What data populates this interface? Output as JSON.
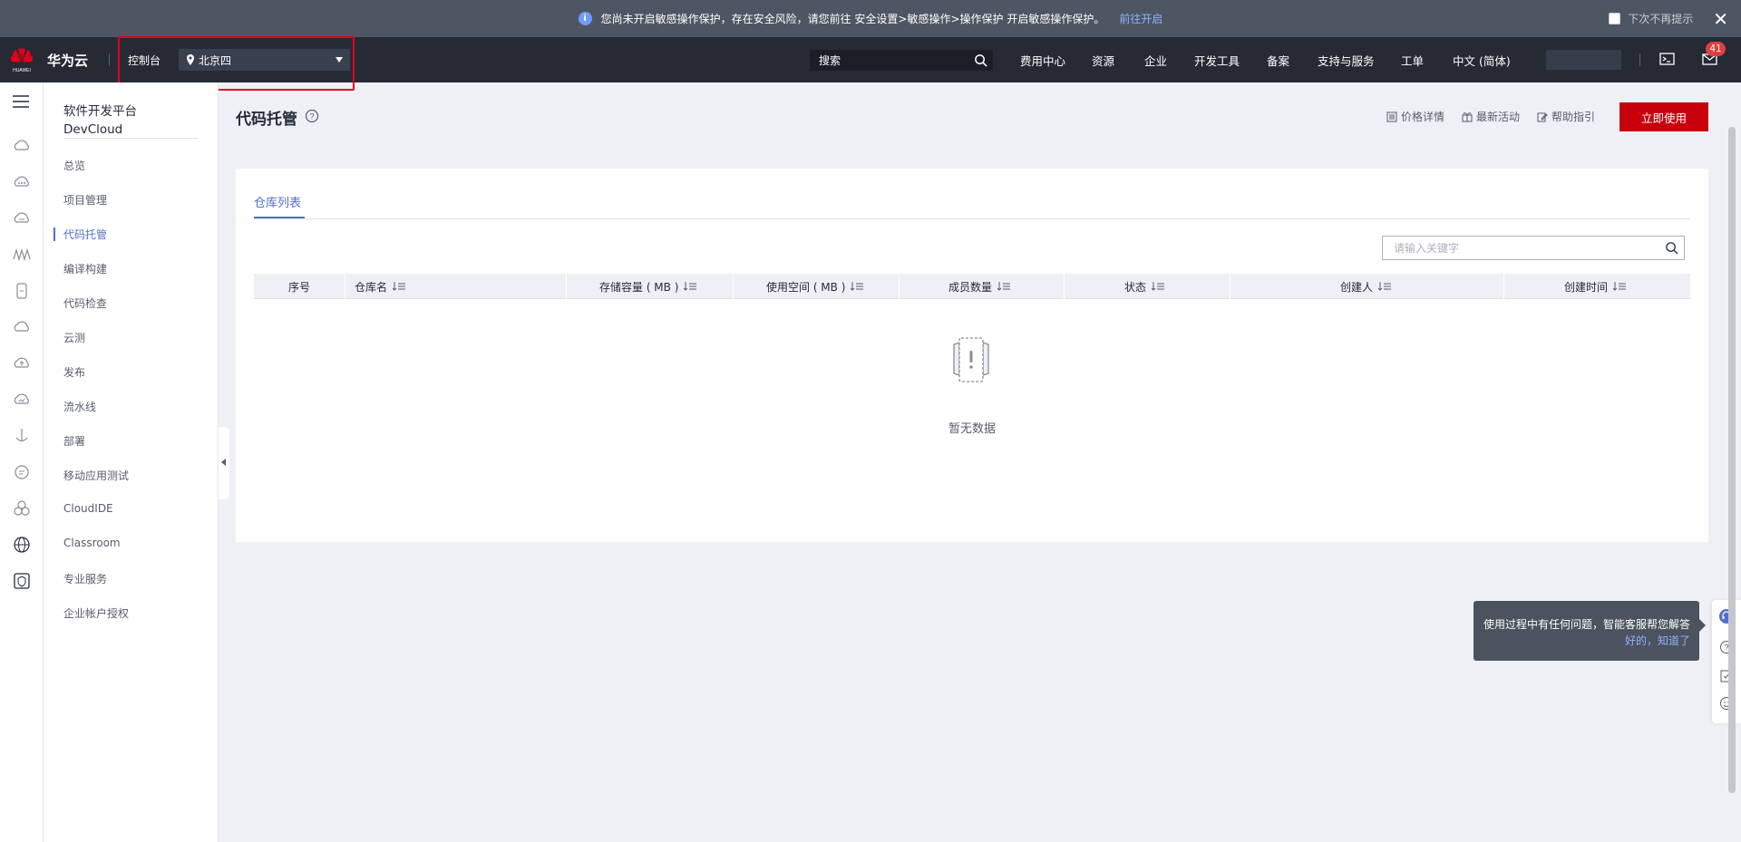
{
  "notice": {
    "text": "您尚未开启敏感操作保护，存在安全风险，请您前往 安全设置>敏感操作>操作保护 开启敏感操作保护。",
    "link": "前往开启",
    "dont_show": "下次不再提示"
  },
  "header": {
    "brand": "华为云",
    "logo_text": "HUAWEI",
    "console": "控制台",
    "region": "北京四",
    "search_placeholder": "搜索",
    "nav": [
      "费用中心",
      "资源",
      "企业",
      "开发工具",
      "备案",
      "支持与服务",
      "工单",
      "中文 (简体)"
    ],
    "message_count": "41"
  },
  "menu": {
    "title_line1": "软件开发平台",
    "title_line2": "DevCloud",
    "items": [
      "总览",
      "项目管理",
      "代码托管",
      "编译构建",
      "代码检查",
      "云测",
      "发布",
      "流水线",
      "部署",
      "移动应用测试",
      "CloudIDE",
      "Classroom",
      "专业服务",
      "企业帐户授权"
    ],
    "active_index": 2
  },
  "main": {
    "title": "代码托管",
    "links": {
      "pricing": "价格详情",
      "activities": "最新活动",
      "guide": "帮助指引"
    },
    "cta": "立即使用",
    "tab": "仓库列表",
    "search_placeholder": "请输入关键字",
    "columns": [
      "序号",
      "仓库名",
      "存储容量 ( MB )",
      "使用空间 ( MB )",
      "成员数量",
      "状态",
      "创建人",
      "创建时间"
    ],
    "empty": "暂无数据"
  },
  "assistant": {
    "message": "使用过程中有任何问题，智能客服帮您解答",
    "ok": "好的，知道了"
  },
  "colors": {
    "accent": "#526ecc",
    "brand_red": "#c7000b",
    "header_bg": "#252a35",
    "notice_bg": "#4e5663"
  }
}
